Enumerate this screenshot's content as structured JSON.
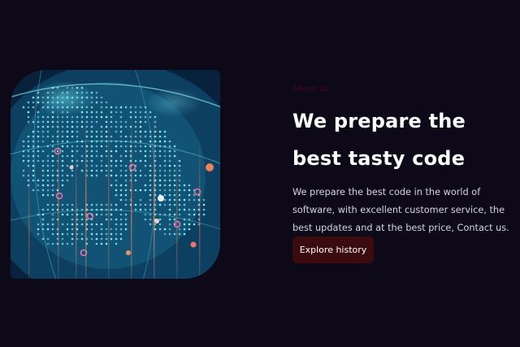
{
  "about": {
    "eyebrow": "About us",
    "heading": "We prepare the best tasty code",
    "description": "We prepare the best code in the world of software, with excellent customer service, the best updates and at the best price, Contact us.",
    "cta_label": "Explore history"
  },
  "colors": {
    "background": "#0e0918",
    "heading": "#ffffff",
    "body_text": "#d7d4df",
    "cta_background": "#3b0b0d",
    "accent": "#3f0a1c"
  },
  "image": {
    "icon": "digital-globe-network"
  }
}
